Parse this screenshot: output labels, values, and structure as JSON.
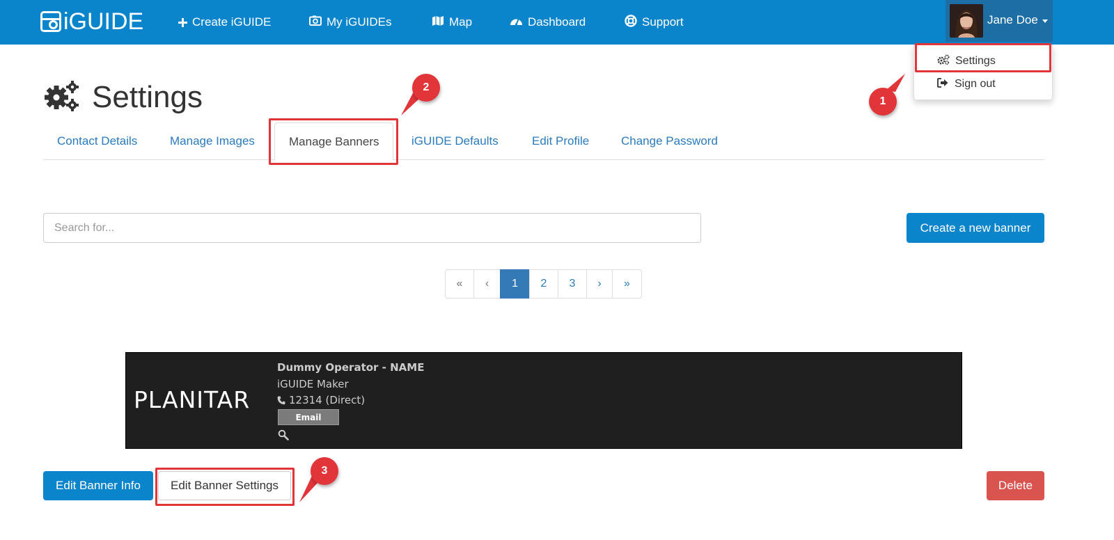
{
  "navbar": {
    "logo_text": "iGUIDE",
    "items": [
      {
        "label": "Create iGUIDE",
        "icon": "plus-icon"
      },
      {
        "label": "My iGUIDEs",
        "icon": "camera-icon"
      },
      {
        "label": "Map",
        "icon": "map-icon"
      },
      {
        "label": "Dashboard",
        "icon": "dashboard-icon"
      },
      {
        "label": "Support",
        "icon": "lifebuoy-icon"
      }
    ],
    "user_name": "Jane Doe"
  },
  "user_menu": {
    "items": [
      {
        "label": "Settings",
        "icon": "gears-icon"
      },
      {
        "label": "Sign out",
        "icon": "sign-out-icon"
      }
    ]
  },
  "annotations": [
    "1",
    "2",
    "3"
  ],
  "page": {
    "title": "Settings",
    "tabs": [
      {
        "label": "Contact Details"
      },
      {
        "label": "Manage Images"
      },
      {
        "label": "Manage Banners",
        "active": true
      },
      {
        "label": "iGUIDE Defaults"
      },
      {
        "label": "Edit Profile"
      },
      {
        "label": "Change Password"
      }
    ]
  },
  "search": {
    "placeholder": "Search for..."
  },
  "create_button": "Create a new banner",
  "pagination": {
    "first": "«",
    "prev": "‹",
    "pages": [
      "1",
      "2",
      "3"
    ],
    "current": "1",
    "next": "›",
    "last": "»"
  },
  "banner": {
    "brand": "PLANITAR",
    "name": "Dummy Operator - NAME",
    "role": "iGUIDE Maker",
    "phone": "12314 (Direct)",
    "email_label": "Email"
  },
  "actions": {
    "edit_info": "Edit Banner Info",
    "edit_settings": "Edit Banner Settings",
    "delete": "Delete"
  },
  "colors": {
    "navbar": "#0a85cc",
    "primary": "#0a85cc",
    "danger": "#d9534f",
    "annotation": "#e2353a",
    "link": "#2a7bbf"
  }
}
